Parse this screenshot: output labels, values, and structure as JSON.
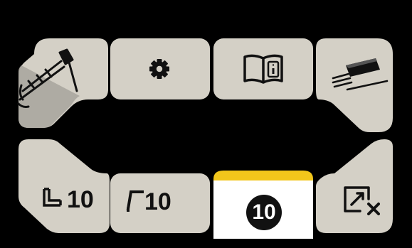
{
  "colors": {
    "background": "#000000",
    "tile": "#d4d0c6",
    "tile_shade": "#aaa69e",
    "active_tile": "#ffffff",
    "active_indicator": "#f2c61b",
    "icon": "#111111"
  },
  "top_row": [
    {
      "name": "torch-tile",
      "icon": "welding-torch-icon"
    },
    {
      "name": "settings-tile",
      "icon": "gear-icon"
    },
    {
      "name": "manual-tile",
      "icon": "book-info-icon"
    },
    {
      "name": "wire-tile",
      "icon": "welding-wire-icon"
    }
  ],
  "bottom_row": {
    "pre_gas": {
      "icon": "pre-gas-time-icon",
      "value": "10"
    },
    "post_gas": {
      "icon": "post-gas-time-icon",
      "value": "10"
    },
    "selected": {
      "value": "10",
      "active": true
    },
    "close_display": {
      "icon": "exit-edit-icon"
    }
  }
}
